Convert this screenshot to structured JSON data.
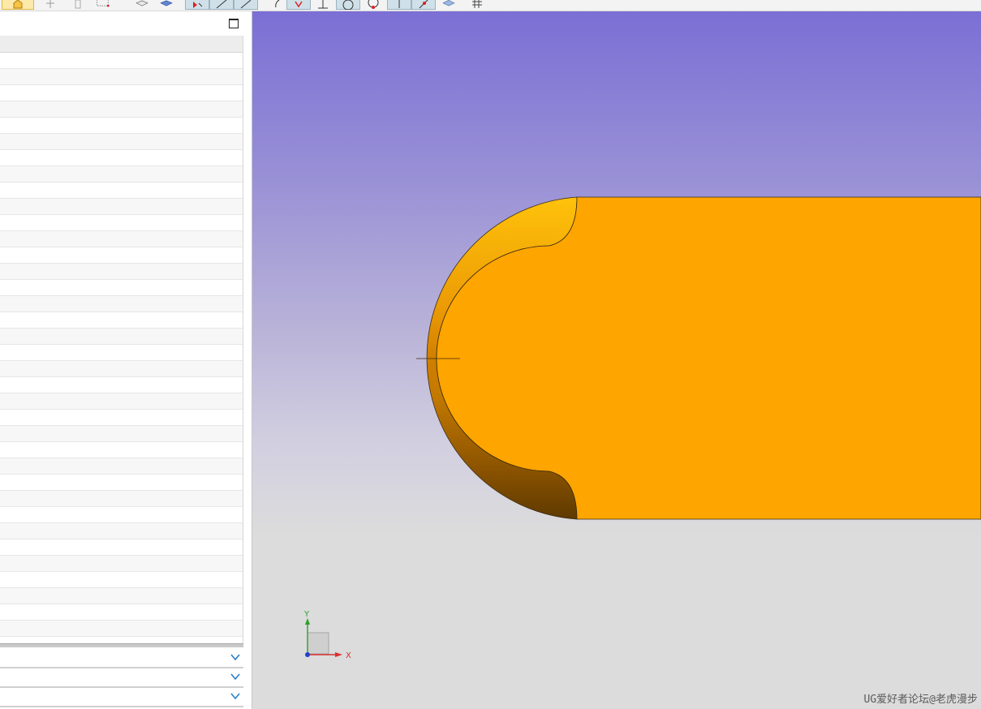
{
  "toolbar": {
    "buttons": [
      {
        "name": "home-view-button",
        "icon": "home-icon",
        "state": "highlighted"
      },
      {
        "name": "snap-point-button",
        "icon": "snap-point-icon",
        "state": "normal"
      },
      {
        "name": "filter-button",
        "icon": "filter-icon",
        "state": "normal"
      },
      {
        "name": "selection-box-button",
        "icon": "selection-box-icon",
        "state": "normal"
      },
      {
        "name": "wireframe-view-button",
        "icon": "wireframe-cube-icon",
        "state": "normal"
      },
      {
        "name": "shaded-view-button",
        "icon": "shaded-cube-icon",
        "state": "normal"
      },
      {
        "name": "select-mode-button",
        "icon": "select-arrow-icon",
        "state": "pressed"
      },
      {
        "name": "line-snap-button",
        "icon": "line-icon",
        "state": "pressed"
      },
      {
        "name": "curve-snap-button",
        "icon": "curve-icon",
        "state": "normal"
      },
      {
        "name": "arc-button",
        "icon": "arc-icon",
        "state": "normal"
      },
      {
        "name": "end-point-button",
        "icon": "end-point-icon",
        "state": "pressed"
      },
      {
        "name": "mid-point-button",
        "icon": "mid-point-icon",
        "state": "normal"
      },
      {
        "name": "circle-center-button",
        "icon": "circle-center-icon",
        "state": "pressed"
      },
      {
        "name": "quadrant-point-button",
        "icon": "quadrant-point-icon",
        "state": "normal"
      },
      {
        "name": "perpendicular-button",
        "icon": "perpendicular-icon",
        "state": "pressed"
      },
      {
        "name": "point-on-curve-button",
        "icon": "point-on-curve-icon",
        "state": "pressed"
      },
      {
        "name": "face-snap-button",
        "icon": "face-icon",
        "state": "normal"
      },
      {
        "name": "grid-button",
        "icon": "grid-icon",
        "state": "normal"
      }
    ]
  },
  "navigator": {
    "row_count": 36
  },
  "sections": [
    {
      "name": "section-1",
      "icon": "chevron-down-icon"
    },
    {
      "name": "section-2",
      "icon": "chevron-down-icon"
    },
    {
      "name": "section-3",
      "icon": "chevron-down-icon"
    }
  ],
  "viewport": {
    "part_color": "#ffa500",
    "triad": {
      "x_label": "X",
      "y_label": "Y"
    },
    "watermark": "UG爱好者论坛@老虎漫步"
  }
}
